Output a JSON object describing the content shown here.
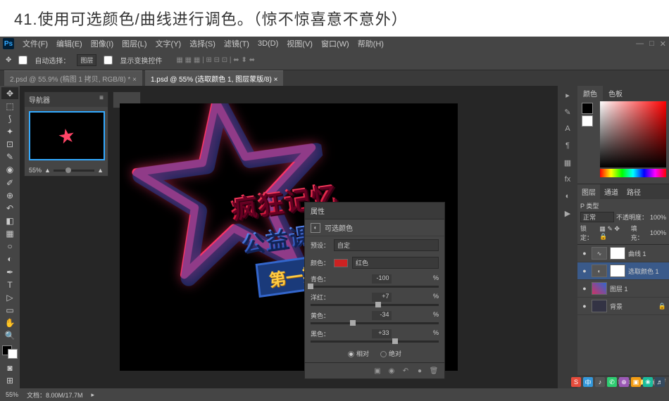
{
  "caption": "41.使用可选颜色/曲线进行调色。（惊不惊喜意不意外）",
  "menu": [
    "文件(F)",
    "编辑(E)",
    "图像(I)",
    "图层(L)",
    "文字(Y)",
    "选择(S)",
    "滤镜(T)",
    "3D(D)",
    "视图(V)",
    "窗口(W)",
    "帮助(H)"
  ],
  "options": {
    "autoSelect": "自动选择：",
    "autoSelectVal": "图层",
    "showTransform": "显示变换控件"
  },
  "tabs": [
    "2.psd @ 55.9% (稿图 1 拷贝, RGB/8) *",
    "1.psd @ 55% (选取颜色 1, 图层蒙版/8)"
  ],
  "navigator": {
    "title": "导航器",
    "zoom": "55%"
  },
  "artwork": {
    "line1": "疯狂记忆",
    "line2": "公益课堂",
    "badge": "第一期"
  },
  "properties": {
    "title": "属性",
    "adjType": "可选颜色",
    "presetLabel": "预设：",
    "presetVal": "自定",
    "colorLabel": "颜色：",
    "colorVal": "红色",
    "sliders": [
      {
        "label": "青色：",
        "value": "-100",
        "pct": "%",
        "pos": 0
      },
      {
        "label": "洋红：",
        "value": "+7",
        "pct": "%",
        "pos": 53
      },
      {
        "label": "黄色：",
        "value": "-34",
        "pct": "%",
        "pos": 33
      },
      {
        "label": "黑色：",
        "value": "+33",
        "pct": "%",
        "pos": 66
      }
    ],
    "radioRelative": "相对",
    "radioAbsolute": "绝对"
  },
  "colorPanel": {
    "tab1": "颜色",
    "tab2": "色板"
  },
  "layers": {
    "tabs": [
      "图层",
      "通道",
      "路径"
    ],
    "kindLabel": "P 类型",
    "blendMode": "正常",
    "opacityLabel": "不透明度：",
    "opacity": "100%",
    "lockLabel": "锁定：",
    "fillLabel": "填充：",
    "fill": "100%",
    "items": [
      {
        "name": "曲线 1",
        "type": "adj",
        "icon": "∿"
      },
      {
        "name": "选取颜色 1",
        "type": "adj",
        "icon": "◐",
        "selected": true
      },
      {
        "name": "图层 1",
        "type": "img"
      },
      {
        "name": "背景",
        "type": "bg",
        "locked": true
      }
    ]
  },
  "status": {
    "zoom": "55%",
    "docinfo": "文档：8.00M/17.7M"
  }
}
